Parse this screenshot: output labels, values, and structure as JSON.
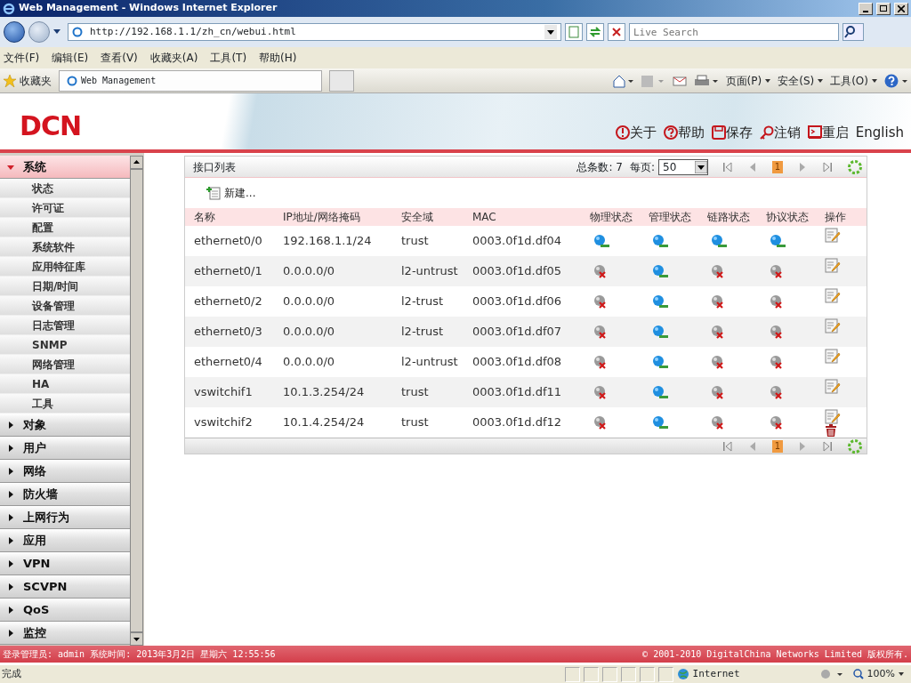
{
  "window": {
    "title": "Web Management - Windows Internet Explorer"
  },
  "browser": {
    "address": "http://192.168.1.1/zh_cn/webui.html",
    "search": {
      "placeholder": "Live Search"
    },
    "menu": [
      "文件(F)",
      "编辑(E)",
      "查看(V)",
      "收藏夹(A)",
      "工具(T)",
      "帮助(H)"
    ],
    "favorites": "收藏夹",
    "tab": "Web Management",
    "commands": [
      "页面(P)",
      "安全(S)",
      "工具(O)"
    ]
  },
  "header": {
    "logo": "DCN",
    "actions": [
      {
        "kind": "about",
        "label": "关于"
      },
      {
        "kind": "help",
        "label": "帮助"
      },
      {
        "kind": "save",
        "label": "保存"
      },
      {
        "kind": "logout",
        "label": "注销"
      },
      {
        "kind": "reboot",
        "label": "重启"
      }
    ],
    "language": "English"
  },
  "sidebar": {
    "items": [
      {
        "label": "系统",
        "expanded": true,
        "children": [
          {
            "label": "状态"
          },
          {
            "label": "许可证"
          },
          {
            "label": "配置"
          },
          {
            "label": "系统软件"
          },
          {
            "label": "应用特征库"
          },
          {
            "label": "日期/时间"
          },
          {
            "label": "设备管理"
          },
          {
            "label": "日志管理"
          },
          {
            "label": "SNMP"
          },
          {
            "label": "网络管理"
          },
          {
            "label": "HA"
          },
          {
            "label": "工具"
          }
        ]
      },
      {
        "label": "对象",
        "expanded": false
      },
      {
        "label": "用户",
        "expanded": false
      },
      {
        "label": "网络",
        "expanded": false
      },
      {
        "label": "防火墙",
        "expanded": false
      },
      {
        "label": "上网行为",
        "expanded": false
      },
      {
        "label": "应用",
        "expanded": false
      },
      {
        "label": "VPN",
        "expanded": false
      },
      {
        "label": "SCVPN",
        "expanded": false
      },
      {
        "label": "QoS",
        "expanded": false
      },
      {
        "label": "监控",
        "expanded": false
      }
    ]
  },
  "panel": {
    "title": "接口列表",
    "total": "总条数: 7",
    "per_page_label": "每页:",
    "per_page": "50",
    "pagers": [
      {
        "page": "1"
      },
      {
        "page": "1"
      }
    ],
    "new_label": "新建...",
    "columns": [
      "名称",
      "IP地址/网络掩码",
      "安全域",
      "MAC",
      "物理状态",
      "管理状态",
      "链路状态",
      "协议状态",
      "操作"
    ],
    "rows": [
      {
        "name": "ethernet0/0",
        "ip": "192.168.1.1/24",
        "zone": "trust",
        "mac": "0003.0f1d.df04",
        "physical_up": true,
        "admin_up": true,
        "link_up": true,
        "protocol_up": true,
        "deletable": false
      },
      {
        "name": "ethernet0/1",
        "ip": "0.0.0.0/0",
        "zone": "l2-untrust",
        "mac": "0003.0f1d.df05",
        "physical_up": false,
        "admin_up": true,
        "link_up": false,
        "protocol_up": false,
        "deletable": false
      },
      {
        "name": "ethernet0/2",
        "ip": "0.0.0.0/0",
        "zone": "l2-trust",
        "mac": "0003.0f1d.df06",
        "physical_up": false,
        "admin_up": true,
        "link_up": false,
        "protocol_up": false,
        "deletable": false
      },
      {
        "name": "ethernet0/3",
        "ip": "0.0.0.0/0",
        "zone": "l2-trust",
        "mac": "0003.0f1d.df07",
        "physical_up": false,
        "admin_up": true,
        "link_up": false,
        "protocol_up": false,
        "deletable": false
      },
      {
        "name": "ethernet0/4",
        "ip": "0.0.0.0/0",
        "zone": "l2-untrust",
        "mac": "0003.0f1d.df08",
        "physical_up": false,
        "admin_up": true,
        "link_up": false,
        "protocol_up": false,
        "deletable": false
      },
      {
        "name": "vswitchif1",
        "ip": "10.1.3.254/24",
        "zone": "trust",
        "mac": "0003.0f1d.df11",
        "physical_up": false,
        "admin_up": true,
        "link_up": false,
        "protocol_up": false,
        "deletable": false
      },
      {
        "name": "vswitchif2",
        "ip": "10.1.4.254/24",
        "zone": "trust",
        "mac": "0003.0f1d.df12",
        "physical_up": false,
        "admin_up": true,
        "link_up": false,
        "protocol_up": false,
        "deletable": true
      }
    ]
  },
  "footer": {
    "login": "登录管理员: admin 系统时间: 2013年3月2日 星期六 12:55:56",
    "copyright": "© 2001-2010 DigitalChina Networks Limited 版权所有."
  },
  "status_bar": {
    "text": "完成",
    "zone": "Internet",
    "zoom": "100%"
  }
}
